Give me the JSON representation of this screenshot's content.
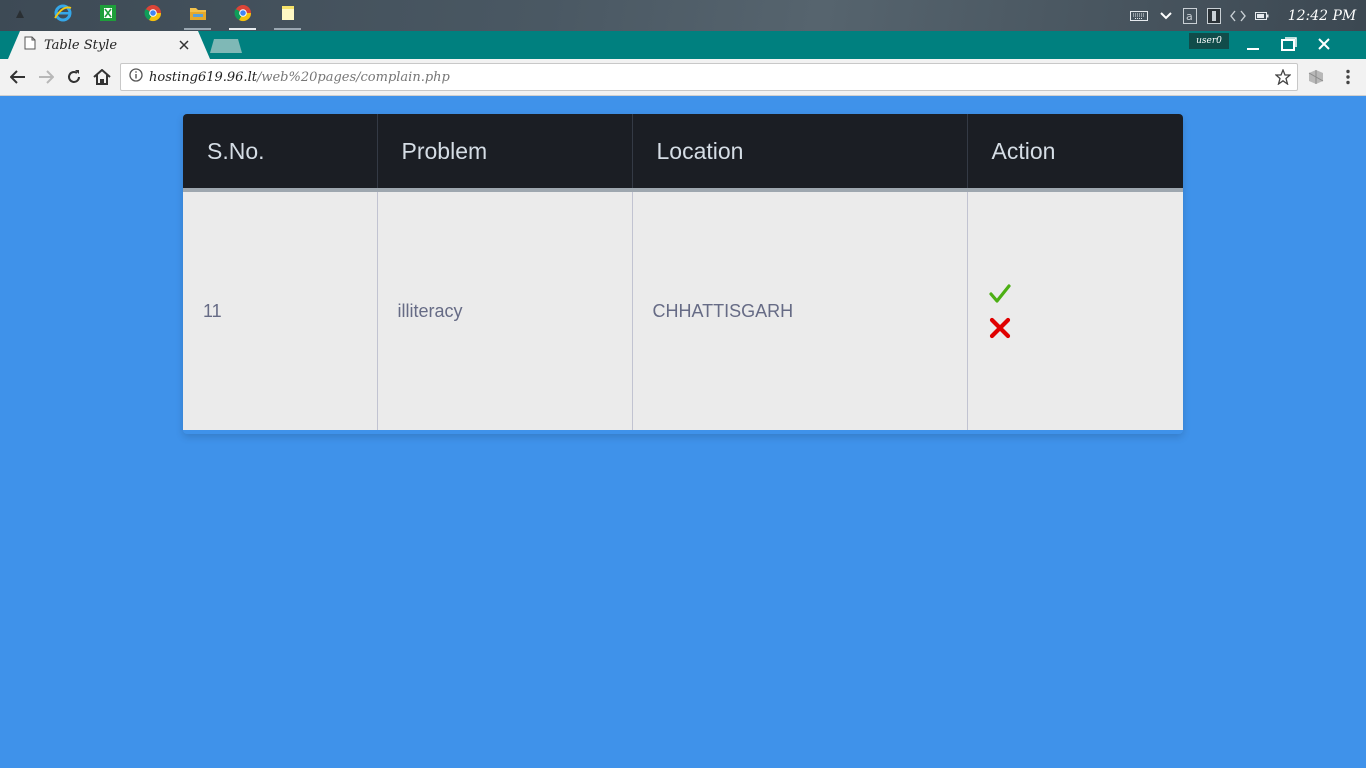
{
  "taskbar": {
    "apps": [
      {
        "icon": "app-menu-icon"
      },
      {
        "icon": "internet-explorer-icon"
      },
      {
        "icon": "spreadsheet-icon"
      },
      {
        "icon": "chrome-icon"
      },
      {
        "icon": "file-explorer-icon"
      },
      {
        "icon": "chrome-icon"
      },
      {
        "icon": "sticky-notes-icon"
      }
    ],
    "tray_icons": [
      "keyboard-icon",
      "chevron-down-icon",
      "a-box-icon",
      "tray-box-icon",
      "code-icon",
      "battery-icon"
    ],
    "clock": "12:42 PM"
  },
  "browser": {
    "tab_title": "Table Style",
    "profile": "user0",
    "url_host": "hosting619.96.lt",
    "url_path": "/web%20pages/complain.php",
    "accent_color": "#00807f"
  },
  "page": {
    "background": "#3f92ea",
    "table": {
      "headers": [
        "S.No.",
        "Problem",
        "Location",
        "Action"
      ],
      "rows": [
        {
          "sno": "11",
          "problem": "illiteracy",
          "location": "CHHATTISGARH"
        }
      ],
      "actions": {
        "approve_icon": "checkmark-icon",
        "reject_icon": "x-icon",
        "approve_color": "#4caf14",
        "reject_color": "#e00000"
      }
    }
  }
}
